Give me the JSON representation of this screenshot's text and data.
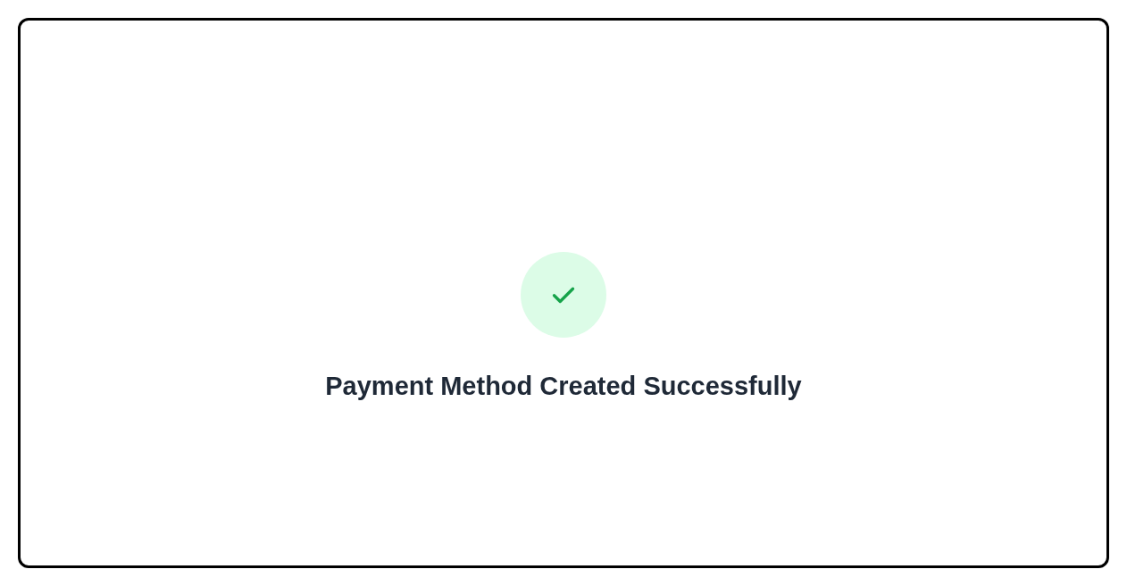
{
  "message": {
    "success": true,
    "title": "Payment Method Created Successfully"
  }
}
